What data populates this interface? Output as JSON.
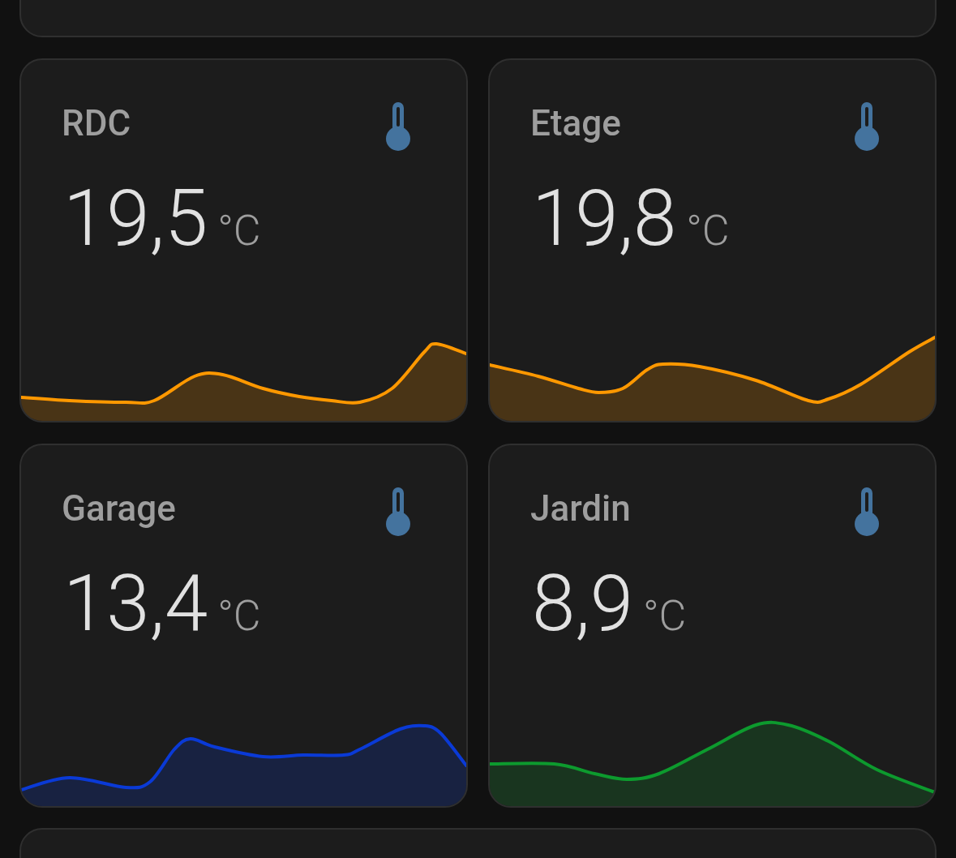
{
  "sensors": [
    {
      "name": "RDC",
      "value": "19,5",
      "unit": "°C",
      "color": "#ff9800"
    },
    {
      "name": "Etage",
      "value": "19,8",
      "unit": "°C",
      "color": "#ff9800"
    },
    {
      "name": "Garage",
      "value": "13,4",
      "unit": "°C",
      "color": "#0a3ad6"
    },
    {
      "name": "Jardin",
      "value": "8,9",
      "unit": "°C",
      "color": "#0d9a2e"
    }
  ]
}
